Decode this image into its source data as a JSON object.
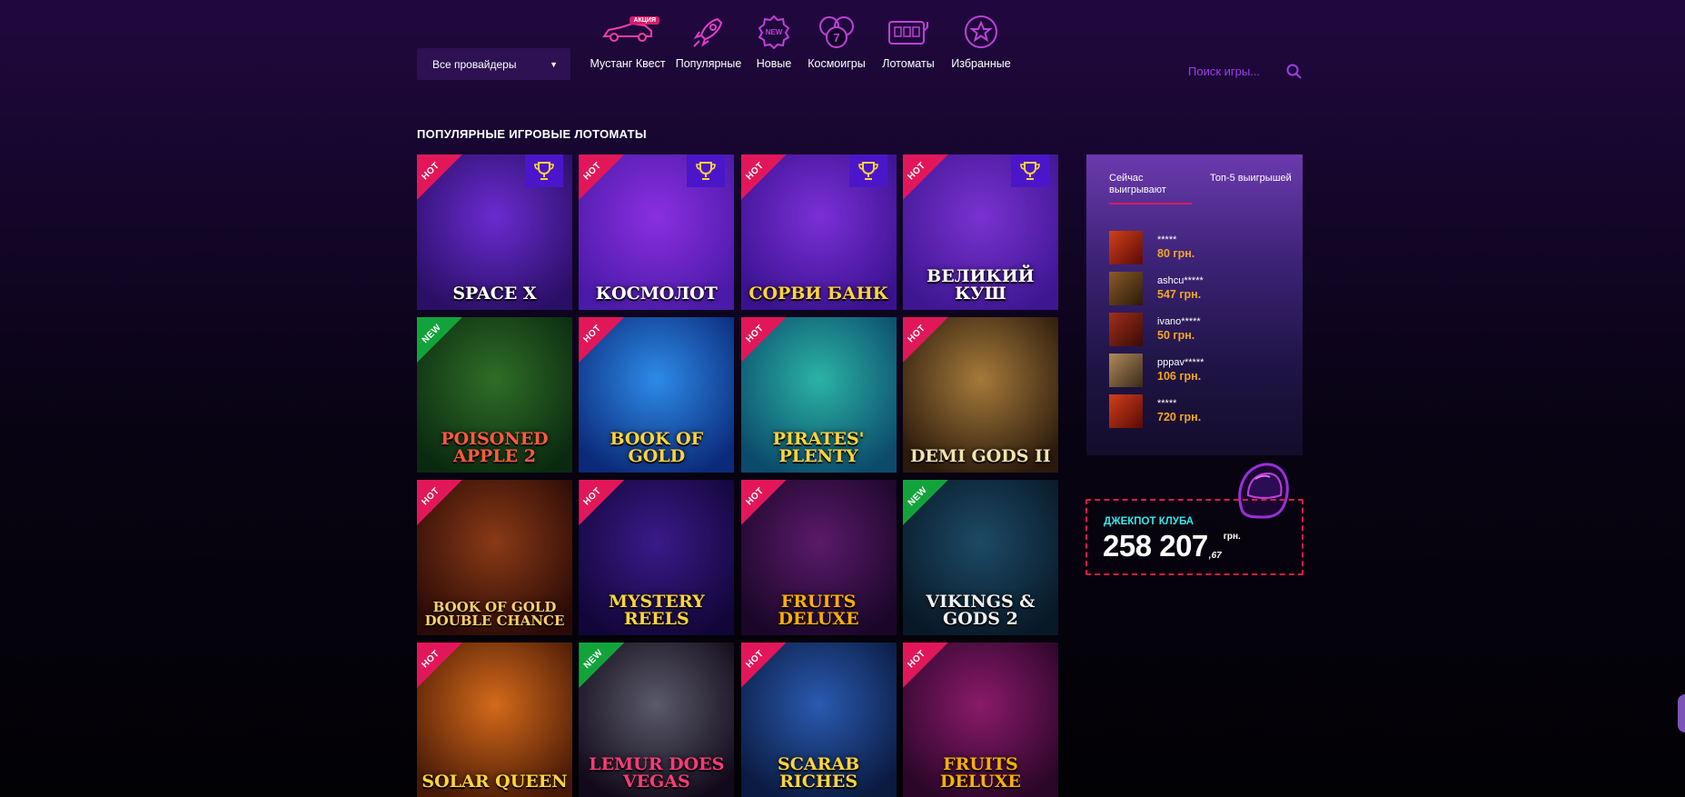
{
  "provider_filter": {
    "label": "Все провайдеры"
  },
  "nav": [
    {
      "label": "Мустанг Квест",
      "icon": "car-icon",
      "badge": "АКЦИЯ"
    },
    {
      "label": "Популярные",
      "icon": "rocket-icon"
    },
    {
      "label": "Новые",
      "icon": "new-badge-icon",
      "icon_text": "NEW"
    },
    {
      "label": "Космоигры",
      "icon": "lucky-sevens-icon"
    },
    {
      "label": "Лотоматы",
      "icon": "slot-machine-icon"
    },
    {
      "label": "Избранные",
      "icon": "star-icon"
    }
  ],
  "search": {
    "placeholder": "Поиск игры..."
  },
  "section_title": "ПОПУЛЯРНЫЕ ИГРОВЫЕ ЛОТОМАТЫ",
  "games": [
    {
      "title": "Space X",
      "badge": "HOT",
      "trophy": true,
      "palette": [
        "#6a2bd0",
        "#2a0f66"
      ],
      "title_color": "#ffffff"
    },
    {
      "title": "Космолот",
      "badge": "HOT",
      "trophy": true,
      "palette": [
        "#8b2fe0",
        "#4a1aa8"
      ],
      "title_color": "#ffffff"
    },
    {
      "title": "Сорви Банк",
      "badge": "HOT",
      "trophy": true,
      "palette": [
        "#7b2fd6",
        "#3a1290"
      ],
      "title_color": "#ffd43a"
    },
    {
      "title": "Великий Куш",
      "badge": "HOT",
      "trophy": true,
      "palette": [
        "#7a32d0",
        "#3e1692"
      ],
      "title_color": "#ffffff"
    },
    {
      "title": "Poisoned Apple 2",
      "badge": "NEW",
      "trophy": false,
      "palette": [
        "#2f6e27",
        "#0a2a10"
      ],
      "title_color": "#ff5a3c"
    },
    {
      "title": "Book of Gold",
      "badge": "HOT",
      "trophy": false,
      "palette": [
        "#2d8be8",
        "#0b2a7a"
      ],
      "title_color": "#ffd43a"
    },
    {
      "title": "Pirates' Plenty",
      "badge": "HOT",
      "trophy": false,
      "palette": [
        "#2bb3a5",
        "#0b4a6b"
      ],
      "title_color": "#ffd43a"
    },
    {
      "title": "Demi Gods II",
      "badge": "HOT",
      "trophy": false,
      "palette": [
        "#a57a3a",
        "#2b1a0c"
      ],
      "title_color": "#f3e3b0"
    },
    {
      "title": "Book of Gold Double Chance",
      "badge": "HOT",
      "trophy": false,
      "palette": [
        "#8a3a16",
        "#2a0a06"
      ],
      "title_color": "#ffcf6a"
    },
    {
      "title": "Mystery Reels",
      "badge": "HOT",
      "trophy": false,
      "palette": [
        "#3a1a8a",
        "#120638"
      ],
      "title_color": "#ffd43a"
    },
    {
      "title": "Fruits Deluxe",
      "badge": "HOT",
      "trophy": false,
      "palette": [
        "#5a1a6a",
        "#1a0628"
      ],
      "title_color": "#ffb000"
    },
    {
      "title": "Vikings & Gods 2",
      "badge": "NEW",
      "trophy": false,
      "palette": [
        "#1d4a66",
        "#081826"
      ],
      "title_color": "#f0f0f0"
    },
    {
      "title": "Solar Queen",
      "badge": "HOT",
      "trophy": false,
      "palette": [
        "#d46a1a",
        "#4a1a06"
      ],
      "title_color": "#ffd43a"
    },
    {
      "title": "Lemur Does Vegas",
      "badge": "NEW",
      "trophy": false,
      "palette": [
        "#5a5a6a",
        "#120a1a"
      ],
      "title_color": "#ff3a7a"
    },
    {
      "title": "Scarab Riches",
      "badge": "HOT",
      "trophy": false,
      "palette": [
        "#2a5ab0",
        "#0a1a40"
      ],
      "title_color": "#ffd43a"
    },
    {
      "title": "Fruits Deluxe",
      "badge": "HOT",
      "trophy": false,
      "palette": [
        "#8a1a6a",
        "#2a0628"
      ],
      "title_color": "#ffb000"
    }
  ],
  "winners": {
    "tabs": [
      "Сейчас выигрывают",
      "Топ-5 выигрышей"
    ],
    "active_tab": 0,
    "rows": [
      {
        "user": "*****",
        "amount": "80 грн.",
        "thumb": [
          "#d0401a",
          "#5a0a06"
        ]
      },
      {
        "user": "ashcu*****",
        "amount": "547 грн.",
        "thumb": [
          "#8a5a2a",
          "#2a1a08"
        ]
      },
      {
        "user": "ivano*****",
        "amount": "50 грн.",
        "thumb": [
          "#a0301a",
          "#3a0a06"
        ]
      },
      {
        "user": "pppav*****",
        "amount": "106 грн.",
        "thumb": [
          "#b08a5a",
          "#3a2a1a"
        ]
      },
      {
        "user": "*****",
        "amount": "720 грн.",
        "thumb": [
          "#d0401a",
          "#5a0a06"
        ]
      }
    ]
  },
  "jackpot": {
    "label": "ДЖЕКПОТ КЛУБА",
    "value": "258 207",
    "cents": ",67",
    "currency": "грн."
  },
  "colors": {
    "accent": "#d81b60",
    "amount": "#f5a623",
    "jackpot_label": "#36e8e8",
    "search": "#9b3fe6"
  }
}
